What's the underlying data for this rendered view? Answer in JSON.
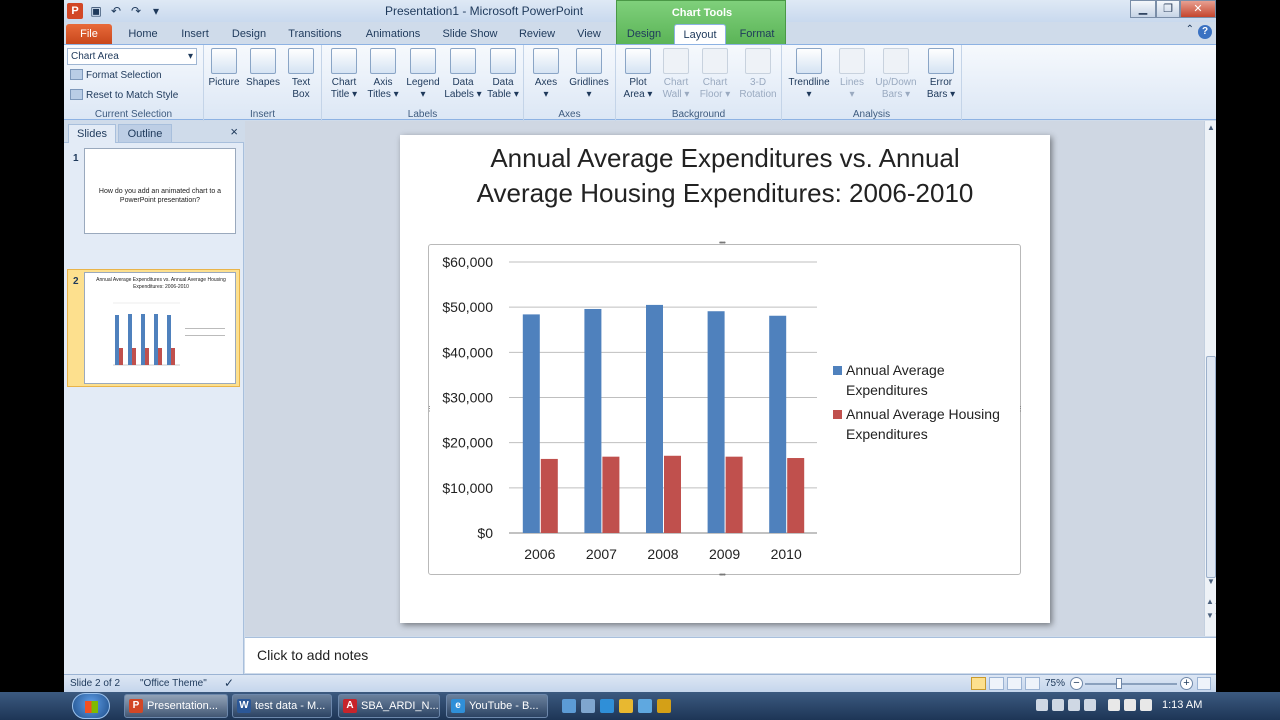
{
  "window": {
    "title": "Presentation1 - Microsoft PowerPoint",
    "contextual_tab": "Chart Tools",
    "min": "▁",
    "restore": "❐",
    "close": "✕"
  },
  "tabs": [
    "File",
    "Home",
    "Insert",
    "Design",
    "Transitions",
    "Animations",
    "Slide Show",
    "Review",
    "View",
    "Design",
    "Layout",
    "Format"
  ],
  "ribbon": {
    "current_selection": {
      "dropdown_value": "Chart Area",
      "format_selection": "Format Selection",
      "reset_style": "Reset to Match Style",
      "label": "Current Selection"
    },
    "insert": {
      "label": "Insert",
      "picture": "Picture",
      "shapes": "Shapes",
      "text_box_1": "Text",
      "text_box_2": "Box"
    },
    "labels": {
      "label": "Labels",
      "chart_title_1": "Chart",
      "chart_title_2": "Title ▾",
      "axis_titles_1": "Axis",
      "axis_titles_2": "Titles ▾",
      "legend_1": "Legend",
      "legend_2": "▾",
      "data_labels_1": "Data",
      "data_labels_2": "Labels ▾",
      "data_table_1": "Data",
      "data_table_2": "Table ▾"
    },
    "axes": {
      "label": "Axes",
      "axes_1": "Axes",
      "axes_2": "▾",
      "gridlines_1": "Gridlines",
      "gridlines_2": "▾"
    },
    "background": {
      "label": "Background",
      "plot_area_1": "Plot",
      "plot_area_2": "Area ▾",
      "chart_wall_1": "Chart",
      "chart_wall_2": "Wall ▾",
      "chart_floor_1": "Chart",
      "chart_floor_2": "Floor ▾",
      "rotation_1": "3-D",
      "rotation_2": "Rotation"
    },
    "analysis": {
      "label": "Analysis",
      "trendline_1": "Trendline",
      "trendline_2": "▾",
      "lines_1": "Lines",
      "lines_2": "▾",
      "updown_1": "Up/Down",
      "updown_2": "Bars ▾",
      "error_1": "Error",
      "error_2": "Bars ▾"
    }
  },
  "left_pane": {
    "tab_slides": "Slides",
    "tab_outline": "Outline",
    "close": "×",
    "slide1_num": "1",
    "slide1_text": "How do you add an animated chart to a PowerPoint presentation?",
    "slide2_num": "2",
    "slide2_title": "Annual Average Expenditures vs. Annual Average Housing Expenditures: 2006-2010"
  },
  "slide": {
    "title_line1": "Annual Average Expenditures vs. Annual",
    "title_line2": "Average Housing Expenditures: 2006-2010"
  },
  "chart_data": {
    "type": "bar",
    "categories": [
      "2006",
      "2007",
      "2008",
      "2009",
      "2010"
    ],
    "series": [
      {
        "name": "Annual Average Expenditures",
        "values": [
          48400,
          49600,
          50500,
          49100,
          48100
        ],
        "color": "#4f81bd"
      },
      {
        "name": "Annual Average Housing Expenditures",
        "values": [
          16400,
          16900,
          17100,
          16900,
          16600
        ],
        "color": "#c0504d"
      }
    ],
    "yticks": [
      "$0",
      "$10,000",
      "$20,000",
      "$30,000",
      "$40,000",
      "$50,000",
      "$60,000"
    ],
    "ylim": [
      0,
      60000
    ],
    "legend_position": "right",
    "grid": true
  },
  "notes": {
    "placeholder": "Click to add notes"
  },
  "status": {
    "slide": "Slide 2 of 2",
    "theme": "\"Office Theme\"",
    "zoom": "75%",
    "zoom_minus": "−",
    "zoom_plus": "+"
  },
  "taskbar": {
    "items": [
      "Presentation...",
      "test data - M...",
      "SBA_ARDI_N...",
      "YouTube - B..."
    ],
    "clock": "1:13 AM"
  }
}
